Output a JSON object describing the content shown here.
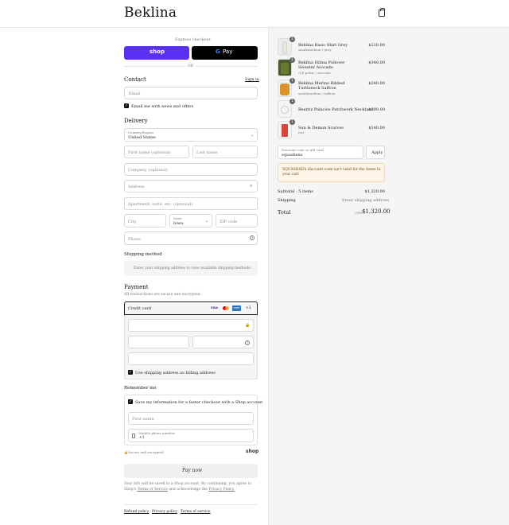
{
  "header": {
    "logo": "Beklina",
    "cart_icon": "shopping-bag-icon"
  },
  "express": {
    "label": "Express checkout",
    "shop_pay": "shop",
    "gpay_g": "G",
    "gpay_text": "Pay",
    "or": "OR"
  },
  "contact": {
    "title": "Contact",
    "sign_in": "Sign in",
    "email_placeholder": "Email",
    "email_news_label": "Email me with news and offers"
  },
  "delivery": {
    "title": "Delivery",
    "country_label": "Country/Region",
    "country_value": "United States",
    "first_name": "First name (optional)",
    "last_name": "Last name",
    "company": "Company (optional)",
    "address": "Address",
    "apartment": "Apartment, suite, etc. (optional)",
    "city": "City",
    "state_label": "State",
    "state_value": "Iowa",
    "zip": "ZIP code",
    "phone": "Phone"
  },
  "shipping": {
    "title": "Shipping method",
    "message": "Enter your shipping address to view available shipping methods."
  },
  "payment": {
    "title": "Payment",
    "subtitle": "All transactions are secure and encrypted.",
    "method": "Credit card",
    "cards": [
      "VISA",
      "MC",
      "AMEX"
    ],
    "more_cards": "+1",
    "billing_same": "Use shipping address as billing address"
  },
  "remember": {
    "title": "Remember me",
    "save_label": "Save my information for a faster checkout with a Shop account",
    "first_name": "First name",
    "phone_label": "Mobile phone number",
    "phone_value": "+1",
    "secure": "Secure and encrypted",
    "shop_logo": "shop"
  },
  "pay_now": "Pay now",
  "legal": {
    "line1": "Your info will be saved to a Shop account. By continuing, you agree to",
    "line2_prefix": "Shop's",
    "terms": "Terms of Service",
    "and": "and acknowledge the",
    "privacy": "Privacy Policy."
  },
  "footer": {
    "refund": "Refund policy",
    "privacy": "Privacy policy",
    "terms": "Terms of service"
  },
  "cart": {
    "items": [
      {
        "name": "Beklina Basic Skirt Grey",
        "variant": "small/medium / grey",
        "price": "$210.00",
        "qty": "1",
        "color": "#e9e4dd"
      },
      {
        "name": "Beklina Hilma Pullover Sweater Avocado",
        "variant": "O/S petite / avocado",
        "price": "$340.00",
        "qty": "1",
        "color": "#4b5a2a"
      },
      {
        "name": "Beklina Merino Ribbed Turtleneck Saffron",
        "variant": "small/medium / saffron",
        "price": "$240.00",
        "qty": "1",
        "color": "#d8942a"
      },
      {
        "name": "Beatriz Palacios Patchwork Necklace",
        "variant": "",
        "price": "$390.00",
        "qty": "1",
        "color": "#e8e8e8"
      },
      {
        "name": "Sun & Demon Scarves",
        "variant": "red",
        "price": "$140.00",
        "qty": "1",
        "color": "#d8453a"
      }
    ],
    "discount_label": "Discount code or gift card",
    "discount_value": "squashsea",
    "apply": "Apply",
    "discount_error": "SQUASHSEA discount code isn't valid for the items in your cart",
    "subtotal_label": "Subtotal · 5 items",
    "subtotal_value": "$1,320.00",
    "shipping_label": "Shipping",
    "shipping_value": "Enter shipping address",
    "total_label": "Total",
    "currency": "USD",
    "total_value": "$1,320.00"
  },
  "colors": {
    "shop_pay": "#5a31f4",
    "error_bg": "#fff4e5"
  }
}
